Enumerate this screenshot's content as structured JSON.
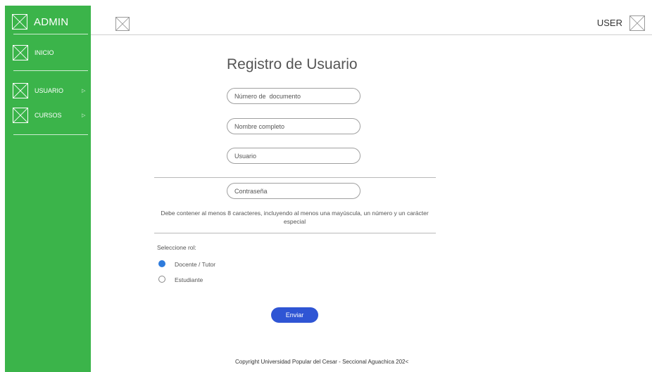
{
  "sidebar": {
    "title": "ADMIN",
    "logo_icon": "image-placeholder-icon",
    "items": [
      {
        "label": "INICIO",
        "icon": "image-placeholder-icon",
        "has_submenu": false
      },
      {
        "label": "USUARIO",
        "icon": "image-placeholder-icon",
        "has_submenu": true,
        "arrow": "▷"
      },
      {
        "label": "CURSOS",
        "icon": "image-placeholder-icon",
        "has_submenu": true,
        "arrow": "▷"
      }
    ],
    "background_color": "#3bb44a"
  },
  "topbar": {
    "left_icon": "image-placeholder-icon",
    "user_label": "USER",
    "avatar_icon": "image-placeholder-icon"
  },
  "form": {
    "title": "Registro de Usuario",
    "fields": {
      "document": {
        "placeholder": "Número de  documento",
        "value": ""
      },
      "full_name": {
        "placeholder": "Nombre completo",
        "value": ""
      },
      "username": {
        "placeholder": "Usuario",
        "value": ""
      },
      "password": {
        "placeholder": "Contraseña",
        "value": ""
      }
    },
    "password_hint": "Debe contener al menos 8 caracteres, incluyendo al menos una mayúscula, un número y un carácter especial",
    "role_label": "Seleccione rol:",
    "roles": [
      {
        "label": "Docente / Tutor",
        "selected": true
      },
      {
        "label": "Estudiante",
        "selected": false
      }
    ],
    "submit_label": "Enviar",
    "accent_color": "#2f55d4",
    "radio_selected_color": "#2f7bdc"
  },
  "footer": {
    "text": "Copyright Universidad Popular del Cesar - Seccional Aguachica 202<"
  }
}
